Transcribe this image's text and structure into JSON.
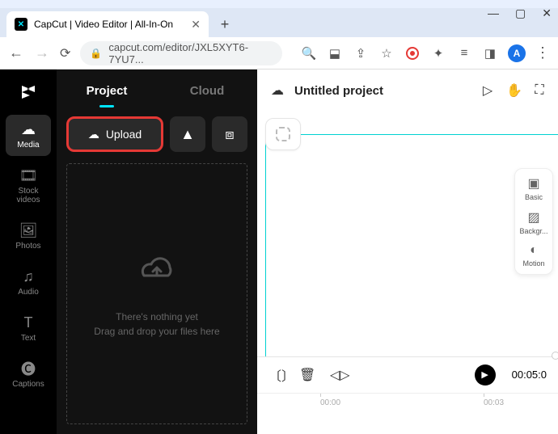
{
  "browser": {
    "tab_title": "CapCut | Video Editor | All-In-On",
    "url": "capcut.com/editor/JXL5XYT6-7YU7...",
    "avatar_letter": "A"
  },
  "rail": {
    "items": [
      {
        "label": "Media"
      },
      {
        "label": "Stock\nvideos"
      },
      {
        "label": "Photos"
      },
      {
        "label": "Audio"
      },
      {
        "label": "Text"
      },
      {
        "label": "Captions"
      }
    ]
  },
  "panel": {
    "tabs": {
      "project": "Project",
      "cloud": "Cloud"
    },
    "upload_label": "Upload",
    "empty_line1": "There's nothing yet",
    "empty_line2": "Drag and drop your files here"
  },
  "canvas": {
    "title": "Untitled project",
    "side_tools": [
      {
        "label": "Basic"
      },
      {
        "label": "Backgr..."
      },
      {
        "label": "Motion"
      }
    ]
  },
  "timeline": {
    "timestamp": "00:05:0",
    "ticks": [
      "00:00",
      "00:03"
    ]
  }
}
